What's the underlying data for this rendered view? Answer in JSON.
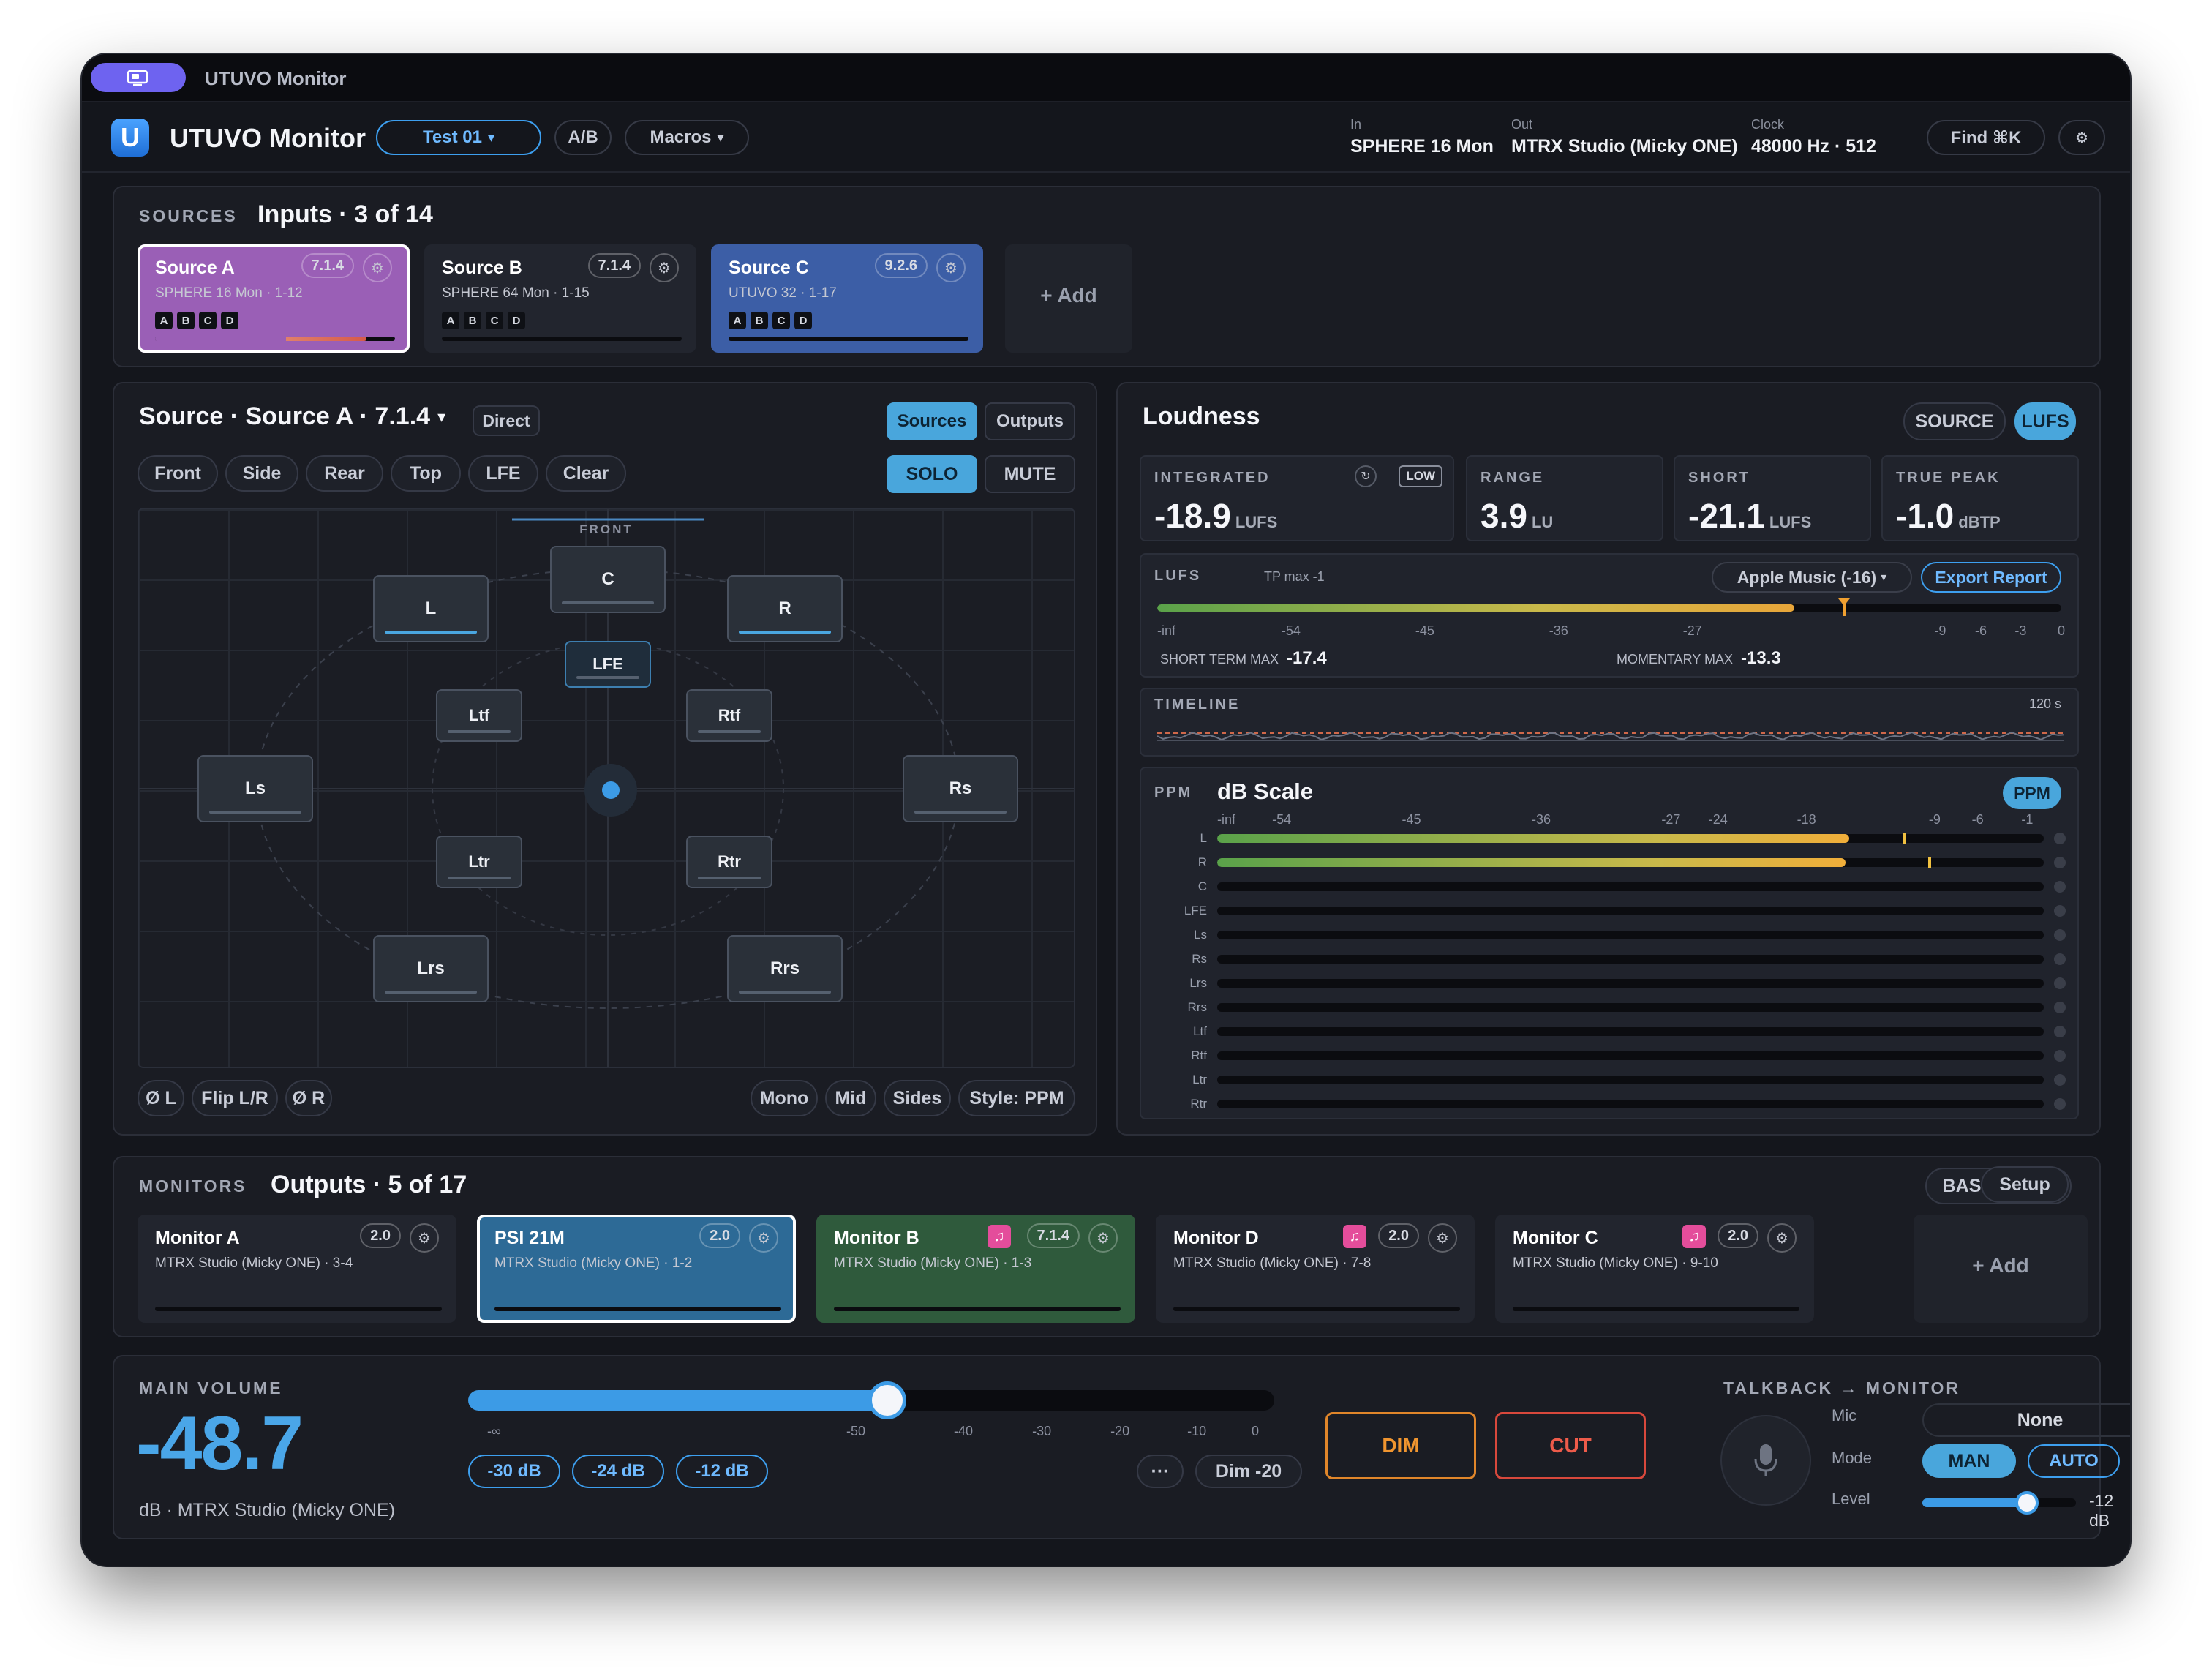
{
  "titlebar": {
    "title": "UTUVO Monitor",
    "icon": "monitor-window-icon"
  },
  "app": {
    "name": "UTUVO Monitor",
    "logo_letter": "U",
    "preset": "Test 01",
    "ab_label": "A/B",
    "macros_label": "Macros",
    "in_label": "In",
    "in_value": "SPHERE 16 Mon",
    "out_label": "Out",
    "out_value": "MTRX Studio (Micky ONE)",
    "clock_label": "Clock",
    "clock_value": "48000 Hz · 512",
    "find_label": "Find ⌘K",
    "settings_icon": "gear-icon"
  },
  "sources": {
    "kicker": "SOURCES",
    "title": "Inputs · 3 of 14",
    "add_label": "+ Add",
    "items": [
      {
        "name": "Source A",
        "format": "7.1.4",
        "sub": "SPHERE 16 Mon · 1-12",
        "tags": [
          "A",
          "B",
          "C",
          "D"
        ],
        "color": "#9a5fb6",
        "selected": true,
        "level": 0.88
      },
      {
        "name": "Source B",
        "format": "7.1.4",
        "sub": "SPHERE 64 Mon · 1-15",
        "tags": [
          "A",
          "B",
          "C",
          "D"
        ],
        "color": "#22252e",
        "selected": false,
        "level": 0
      },
      {
        "name": "Source C",
        "format": "9.2.6",
        "sub": "UTUVO 32 · 1-17",
        "tags": [
          "A",
          "B",
          "C",
          "D"
        ],
        "color": "#3c5ea6",
        "selected": false,
        "level": 0
      }
    ]
  },
  "source_panel": {
    "title": "Source · Source A · 7.1.4",
    "mode": "Direct",
    "view_tabs": [
      "Sources",
      "Outputs"
    ],
    "filters": [
      "Front",
      "Side",
      "Rear",
      "Top",
      "LFE",
      "Clear"
    ],
    "solo": "SOLO",
    "mute": "MUTE",
    "front_label": "FRONT",
    "speakers": {
      "L": "L",
      "C": "C",
      "R": "R",
      "LFE": "LFE",
      "Ltf": "Ltf",
      "Rtf": "Rtf",
      "Ls": "Ls",
      "Rs": "Rs",
      "Ltr": "Ltr",
      "Rtr": "Rtr",
      "Lrs": "Lrs",
      "Rrs": "Rrs"
    },
    "bottom_left": [
      "Ø L",
      "Flip L/R",
      "Ø R"
    ],
    "bottom_right": [
      "Mono",
      "Mid",
      "Sides",
      "Style: PPM"
    ]
  },
  "loudness": {
    "title": "Loudness",
    "toggle": [
      "SOURCE",
      "LUFS"
    ],
    "integrated_label": "INTEGRATED",
    "integrated_value": "-18.9",
    "integrated_unit": "LUFS",
    "integrated_badge": "LOW",
    "range_label": "RANGE",
    "range_value": "3.9",
    "range_unit": "LU",
    "short_label": "SHORT",
    "short_value": "-21.1",
    "short_unit": "LUFS",
    "truepeak_label": "TRUE PEAK",
    "truepeak_value": "-1.0",
    "truepeak_unit": "dBTP",
    "lufs_label": "LUFS",
    "tp_max": "TP max -1",
    "target": "Apple Music (-16)",
    "export": "Export Report",
    "lufs_ticks": [
      "-inf",
      "-54",
      "-45",
      "-36",
      "-27",
      "-9",
      "-6",
      "-3",
      "0"
    ],
    "lufs_level": 0.705,
    "lufs_marker": 0.76,
    "short_term_max_label": "SHORT TERM MAX",
    "short_term_max": "-17.4",
    "momentary_max_label": "MOMENTARY MAX",
    "momentary_max": "-13.3",
    "timeline_label": "TIMELINE",
    "timeline_span": "120 s"
  },
  "ppm": {
    "kicker": "PPM",
    "title": "dB Scale",
    "badge": "PPM",
    "ticks": [
      "-inf",
      "-54",
      "-45",
      "-36",
      "-27",
      "-24",
      "-18",
      "-9",
      "-6",
      "-1"
    ],
    "channels": [
      {
        "name": "L",
        "level": 0.765,
        "peak": 0.83
      },
      {
        "name": "R",
        "level": 0.76,
        "peak": 0.86
      },
      {
        "name": "C",
        "level": 0,
        "peak": 0
      },
      {
        "name": "LFE",
        "level": 0,
        "peak": 0
      },
      {
        "name": "Ls",
        "level": 0,
        "peak": 0
      },
      {
        "name": "Rs",
        "level": 0,
        "peak": 0
      },
      {
        "name": "Lrs",
        "level": 0,
        "peak": 0
      },
      {
        "name": "Rrs",
        "level": 0,
        "peak": 0
      },
      {
        "name": "Ltf",
        "level": 0,
        "peak": 0
      },
      {
        "name": "Rtf",
        "level": 0,
        "peak": 0
      },
      {
        "name": "Ltr",
        "level": 0,
        "peak": 0
      },
      {
        "name": "Rtr",
        "level": 0,
        "peak": 0
      }
    ]
  },
  "monitors": {
    "kicker": "MONITORS",
    "title": "Outputs · 5 of 17",
    "bass_mgmt": "BASS MGMT",
    "setup": "Setup",
    "add_label": "+ Add",
    "items": [
      {
        "name": "Monitor A",
        "format": "2.0",
        "sub": "MTRX Studio (Micky ONE) · 3-4",
        "color": "#22252e",
        "music": false,
        "selected": false
      },
      {
        "name": "PSI 21M",
        "format": "2.0",
        "sub": "MTRX Studio (Micky ONE) · 1-2",
        "color": "#2d6a96",
        "music": false,
        "selected": true
      },
      {
        "name": "Monitor B",
        "format": "7.1.4",
        "sub": "MTRX Studio (Micky ONE) · 1-3",
        "color": "#2f5a3c",
        "music": true,
        "selected": false
      },
      {
        "name": "Monitor D",
        "format": "2.0",
        "sub": "MTRX Studio (Micky ONE) · 7-8",
        "color": "#22252e",
        "music": true,
        "selected": false
      },
      {
        "name": "Monitor C",
        "format": "2.0",
        "sub": "MTRX Studio (Micky ONE) · 9-10",
        "color": "#22252e",
        "music": true,
        "selected": false
      }
    ]
  },
  "volume": {
    "kicker": "MAIN VOLUME",
    "value": "-48.7",
    "unit_line": "dB · MTRX Studio (Micky ONE)",
    "slider_fraction": 0.52,
    "ticks": [
      "-∞",
      "-50",
      "-40",
      "-30",
      "-20",
      "-10",
      "0"
    ],
    "presets": [
      "-30 dB",
      "-24 dB",
      "-12 dB"
    ],
    "more": "···",
    "dim_setting": "Dim -20",
    "dim": "DIM",
    "cut": "CUT"
  },
  "talkback": {
    "title": "TALKBACK → MONITOR",
    "mic_label": "Mic",
    "mic_value": "None",
    "mode_label": "Mode",
    "modes": [
      "MAN",
      "AUTO"
    ],
    "level_label": "Level",
    "level_value": "-12 dB",
    "level_fraction": 0.68
  }
}
